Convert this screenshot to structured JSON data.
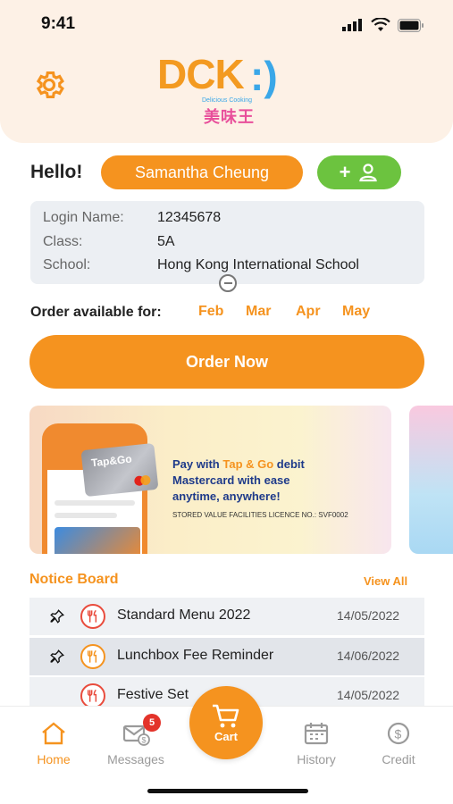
{
  "status": {
    "time": "9:41"
  },
  "logo": {
    "text": "DCK",
    "smile": ":)",
    "tagline": "Delicious Cooking",
    "chinese": "美味王"
  },
  "greeting": {
    "hello": "Hello!",
    "user_name": "Samantha Cheung",
    "add_user_label": "+"
  },
  "profile": {
    "login_label": "Login Name:",
    "login_value": "12345678",
    "class_label": "Class:",
    "class_value": "5A",
    "school_label": "School:",
    "school_value": "Hong Kong International School"
  },
  "order": {
    "available_label": "Order available for:",
    "months": [
      "Feb",
      "Mar",
      "Apr",
      "May"
    ],
    "order_now": "Order Now"
  },
  "banner": {
    "line1_pre": "Pay with ",
    "line1_hl": "Tap & Go",
    "line1_post": " debit",
    "line2": "Mastercard with ease",
    "line3": "anytime, anywhere!",
    "licence": "STORED VALUE FACILITIES LICENCE NO.: SVF0002",
    "card_brand": "Tap&Go"
  },
  "notice_board": {
    "title": "Notice Board",
    "view_all": "View All",
    "items": [
      {
        "title": "Standard Menu 2022",
        "date": "14/05/2022",
        "pinned": true
      },
      {
        "title": "Lunchbox Fee Reminder",
        "date": "14/06/2022",
        "pinned": true
      },
      {
        "title": "Festive Set",
        "date": "14/05/2022",
        "pinned": false
      }
    ]
  },
  "tabbar": {
    "home": "Home",
    "messages": "Messages",
    "messages_badge": "5",
    "cart": "Cart",
    "history": "History",
    "credit": "Credit"
  },
  "colors": {
    "accent": "#f5931f",
    "green": "#6cc33f",
    "badge": "#e3332a"
  }
}
